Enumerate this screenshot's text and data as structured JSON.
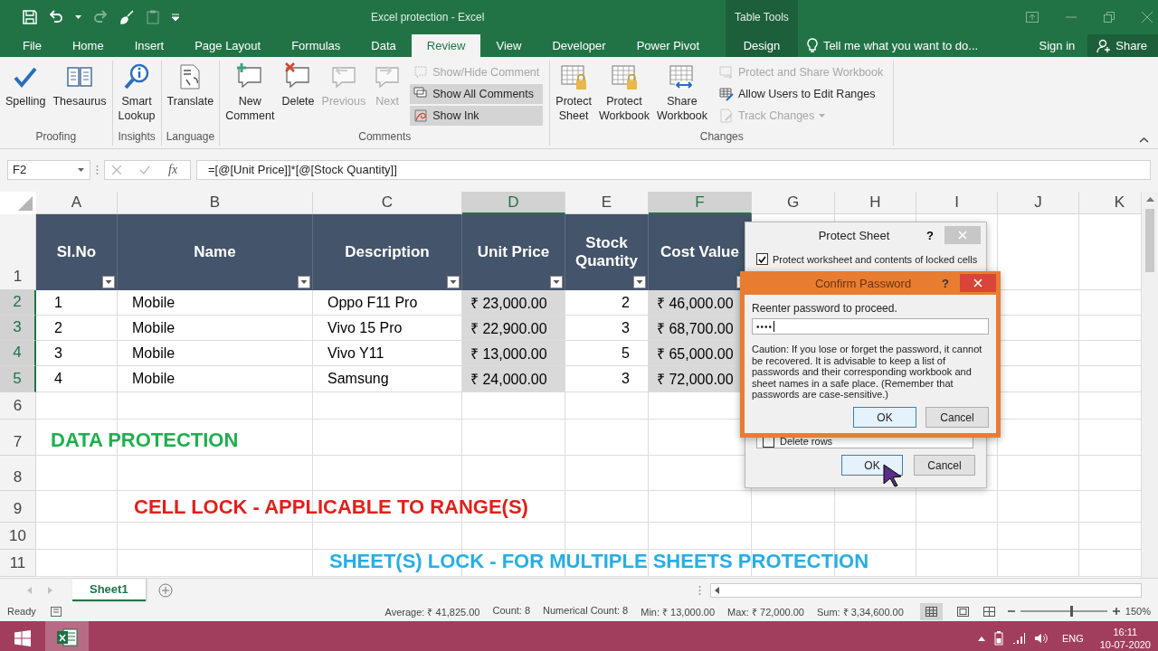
{
  "window": {
    "title": "Excel protection - Excel",
    "contextual_group": "Table Tools"
  },
  "ribbon_tabs": [
    {
      "label": "File",
      "selected": false,
      "kind": "normal"
    },
    {
      "label": "Home",
      "selected": false,
      "kind": "normal"
    },
    {
      "label": "Insert",
      "selected": false,
      "kind": "normal"
    },
    {
      "label": "Page Layout",
      "selected": false,
      "kind": "normal"
    },
    {
      "label": "Formulas",
      "selected": false,
      "kind": "normal"
    },
    {
      "label": "Data",
      "selected": false,
      "kind": "normal"
    },
    {
      "label": "Review",
      "selected": true,
      "kind": "normal"
    },
    {
      "label": "View",
      "selected": false,
      "kind": "normal"
    },
    {
      "label": "Developer",
      "selected": false,
      "kind": "normal"
    },
    {
      "label": "Power Pivot",
      "selected": false,
      "kind": "normal"
    },
    {
      "label": "Design",
      "selected": false,
      "kind": "contextual"
    }
  ],
  "tell_me": {
    "placeholder": "Tell me what you want to do..."
  },
  "sign_in": "Sign in",
  "share_button": "Share",
  "ribbon_groups": [
    {
      "label": "Proofing",
      "commands": [
        {
          "label": "Spelling",
          "kind": "large",
          "disabled": false,
          "on": false
        },
        {
          "label": "Thesaurus",
          "kind": "large",
          "disabled": false,
          "on": false
        }
      ]
    },
    {
      "label": "Insights",
      "commands": [
        {
          "label": "Smart Lookup",
          "kind": "large",
          "disabled": false,
          "on": false
        }
      ]
    },
    {
      "label": "Language",
      "commands": [
        {
          "label": "Translate",
          "kind": "large",
          "disabled": false,
          "on": false
        }
      ]
    },
    {
      "label": "Comments",
      "commands": [
        {
          "label": "New Comment",
          "kind": "large",
          "disabled": false,
          "on": false
        },
        {
          "label": "Delete",
          "kind": "large",
          "disabled": false,
          "on": false
        },
        {
          "label": "Previous",
          "kind": "large",
          "disabled": true,
          "on": false
        },
        {
          "label": "Next",
          "kind": "large",
          "disabled": true,
          "on": false
        },
        {
          "label": "Show/Hide Comment",
          "kind": "small",
          "disabled": true,
          "on": false
        },
        {
          "label": "Show All Comments",
          "kind": "small",
          "disabled": false,
          "on": true
        },
        {
          "label": "Show Ink",
          "kind": "small",
          "disabled": false,
          "on": true
        }
      ]
    },
    {
      "label": "Changes",
      "commands": [
        {
          "label": "Protect Sheet",
          "kind": "large",
          "disabled": false,
          "on": false
        },
        {
          "label": "Protect Workbook",
          "kind": "large",
          "disabled": false,
          "on": false
        },
        {
          "label": "Share Workbook",
          "kind": "large",
          "disabled": false,
          "on": false
        },
        {
          "label": "Protect and Share Workbook",
          "kind": "small",
          "disabled": true,
          "on": false
        },
        {
          "label": "Allow Users to Edit Ranges",
          "kind": "small",
          "disabled": false,
          "on": false
        },
        {
          "label": "Track Changes",
          "kind": "small-menu",
          "disabled": true,
          "on": false
        }
      ]
    }
  ],
  "formula_bar": {
    "name_box": "F2",
    "function_label": "fx",
    "formula": "=[@[Unit Price]]*[@[Stock Quantity]]"
  },
  "column_headers": [
    {
      "label": "A",
      "selected": false
    },
    {
      "label": "B",
      "selected": false
    },
    {
      "label": "C",
      "selected": false
    },
    {
      "label": "D",
      "selected": true
    },
    {
      "label": "E",
      "selected": false
    },
    {
      "label": "F",
      "selected": true
    },
    {
      "label": "G",
      "selected": false
    },
    {
      "label": "H",
      "selected": false
    },
    {
      "label": "I",
      "selected": false
    },
    {
      "label": "J",
      "selected": false
    },
    {
      "label": "K",
      "selected": false
    }
  ],
  "row_headers": [
    {
      "label": "1",
      "selected": false
    },
    {
      "label": "2",
      "selected": true
    },
    {
      "label": "3",
      "selected": true
    },
    {
      "label": "4",
      "selected": true
    },
    {
      "label": "5",
      "selected": true
    },
    {
      "label": "6",
      "selected": false
    },
    {
      "label": "7",
      "selected": false
    },
    {
      "label": "8",
      "selected": false
    },
    {
      "label": "9",
      "selected": false
    },
    {
      "label": "10",
      "selected": false
    },
    {
      "label": "11",
      "selected": false
    }
  ],
  "table": {
    "columns": [
      "Sl.No",
      "Name",
      "Description",
      "Unit Price",
      "Stock Quantity",
      "Cost Value"
    ],
    "rows": [
      {
        "cells": [
          "1",
          "Mobile",
          "Oppo F11 Pro",
          "₹ 23,000.00",
          "2",
          "₹ 46,000.00"
        ]
      },
      {
        "cells": [
          "2",
          "Mobile",
          "Vivo 15 Pro",
          "₹ 22,900.00",
          "3",
          "₹ 68,700.00"
        ]
      },
      {
        "cells": [
          "3",
          "Mobile",
          "Vivo Y11",
          "₹ 13,000.00",
          "5",
          "₹ 65,000.00"
        ]
      },
      {
        "cells": [
          "4",
          "Mobile",
          "Samsung",
          "₹ 24,000.00",
          "3",
          "₹ 72,000.00"
        ]
      }
    ]
  },
  "sheet_notes": [
    {
      "text": "DATA PROTECTION",
      "color": "#1fae4f"
    },
    {
      "text": "CELL LOCK - APPLICABLE TO RANGE(S)",
      "color": "#e0201b"
    },
    {
      "text": "SHEET(S) LOCK - FOR MULTIPLE SHEETS PROTECTION",
      "color": "#26aee3"
    }
  ],
  "sheet_tabs": [
    {
      "label": "Sheet1",
      "selected": true
    }
  ],
  "status_bar": {
    "mode": "Ready",
    "stats": [
      "Average: ₹ 41,825.00",
      "Count: 8",
      "Numerical Count: 8",
      "Min: ₹ 13,000.00",
      "Max: ₹ 72,000.00",
      "Sum: ₹ 3,34,600.00"
    ],
    "zoom": {
      "level": 0.58,
      "reading": "150%"
    }
  },
  "protect_sheet_dialog": {
    "title": "Protect Sheet",
    "help": "?",
    "option": {
      "label": "Protect worksheet and contents of locked cells",
      "checked": true
    },
    "permission": {
      "label": "Delete rows",
      "checked": false
    },
    "buttons": [
      "OK",
      "Cancel"
    ]
  },
  "confirm_password_dialog": {
    "title": "Confirm Password",
    "help": "?",
    "prompt": "Reenter password to proceed.",
    "password": "••••",
    "caution": "Caution: If you lose or forget the password, it cannot be recovered. It is advisable to keep a list of passwords and their corresponding workbook and sheet names in a safe place.  (Remember that passwords are case-sensitive.)",
    "buttons": [
      "OK",
      "Cancel"
    ]
  },
  "taskbar": {
    "language": "ENG",
    "time": "16:11",
    "date": "10-07-2020"
  }
}
